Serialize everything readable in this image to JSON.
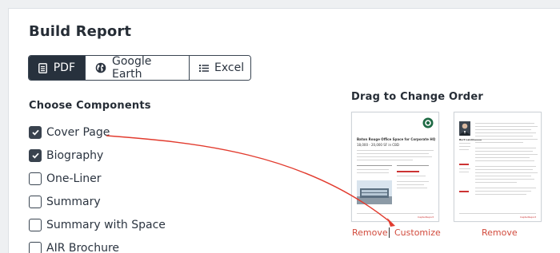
{
  "title": "Build Report",
  "tabs": [
    {
      "label": "PDF",
      "icon": "document-icon",
      "active": true
    },
    {
      "label": "Google Earth",
      "icon": "globe-icon",
      "active": false
    },
    {
      "label": "Excel",
      "icon": "list-icon",
      "active": false
    }
  ],
  "choose_heading": "Choose Components",
  "components": [
    {
      "label": "Cover Page",
      "checked": true
    },
    {
      "label": "Biography",
      "checked": true
    },
    {
      "label": "One-Liner",
      "checked": false
    },
    {
      "label": "Summary",
      "checked": false
    },
    {
      "label": "Summary with Space",
      "checked": false
    },
    {
      "label": "AIR Brochure",
      "checked": false
    }
  ],
  "order_heading": "Drag to Change Order",
  "pages": [
    {
      "title": "Baton Rouge Office Space for Corporate HQ",
      "subtitle": "18,000 - 20,000 SF in CBD",
      "brand": "CapterReport"
    },
    {
      "name": "Bert Landmesser",
      "brand": "CapterReport"
    }
  ],
  "actions": {
    "remove": "Remove",
    "customize": "Customize",
    "remove2": "Remove"
  },
  "colors": {
    "accent": "#d24b3d",
    "dark": "#27313d"
  }
}
